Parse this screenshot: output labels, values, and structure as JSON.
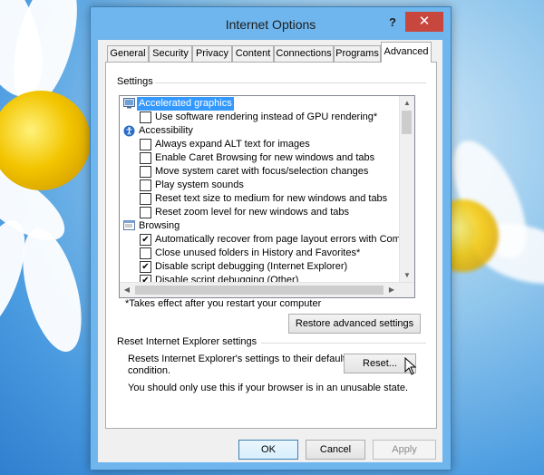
{
  "window": {
    "title": "Internet Options",
    "help_symbol": "?",
    "close_symbol": "✕"
  },
  "tabs": [
    {
      "label": "General"
    },
    {
      "label": "Security"
    },
    {
      "label": "Privacy"
    },
    {
      "label": "Content"
    },
    {
      "label": "Connections"
    },
    {
      "label": "Programs"
    },
    {
      "label": "Advanced",
      "active": true
    }
  ],
  "settings": {
    "group_label": "Settings",
    "items": [
      {
        "type": "category",
        "label": "Accelerated graphics",
        "icon": "monitor-icon",
        "selected": true
      },
      {
        "type": "check",
        "label": "Use software rendering instead of GPU rendering*",
        "checked": false
      },
      {
        "type": "category",
        "label": "Accessibility",
        "icon": "accessibility-icon"
      },
      {
        "type": "check",
        "label": "Always expand ALT text for images",
        "checked": false
      },
      {
        "type": "check",
        "label": "Enable Caret Browsing for new windows and tabs",
        "checked": false
      },
      {
        "type": "check",
        "label": "Move system caret with focus/selection changes",
        "checked": false
      },
      {
        "type": "check",
        "label": "Play system sounds",
        "checked": false
      },
      {
        "type": "check",
        "label": "Reset text size to medium for new windows and tabs",
        "checked": false
      },
      {
        "type": "check",
        "label": "Reset zoom level for new windows and tabs",
        "checked": false
      },
      {
        "type": "category",
        "label": "Browsing",
        "icon": "browser-window-icon"
      },
      {
        "type": "check",
        "label": "Automatically recover from page layout errors with Compa",
        "checked": true
      },
      {
        "type": "check",
        "label": "Close unused folders in History and Favorites*",
        "checked": false
      },
      {
        "type": "check",
        "label": "Disable script debugging (Internet Explorer)",
        "checked": true
      },
      {
        "type": "check",
        "label": "Disable script debugging (Other)",
        "checked": true
      }
    ],
    "note": "*Takes effect after you restart your computer",
    "restore_button": "Restore advanced settings"
  },
  "reset": {
    "group_label": "Reset Internet Explorer settings",
    "description_line1": "Resets Internet Explorer's settings to their default",
    "description_line2": "condition.",
    "reset_button": "Reset...",
    "warning": "You should only use this if your browser is in an unusable state."
  },
  "footer": {
    "ok": "OK",
    "cancel": "Cancel",
    "apply": "Apply"
  },
  "checkmark": "✔"
}
